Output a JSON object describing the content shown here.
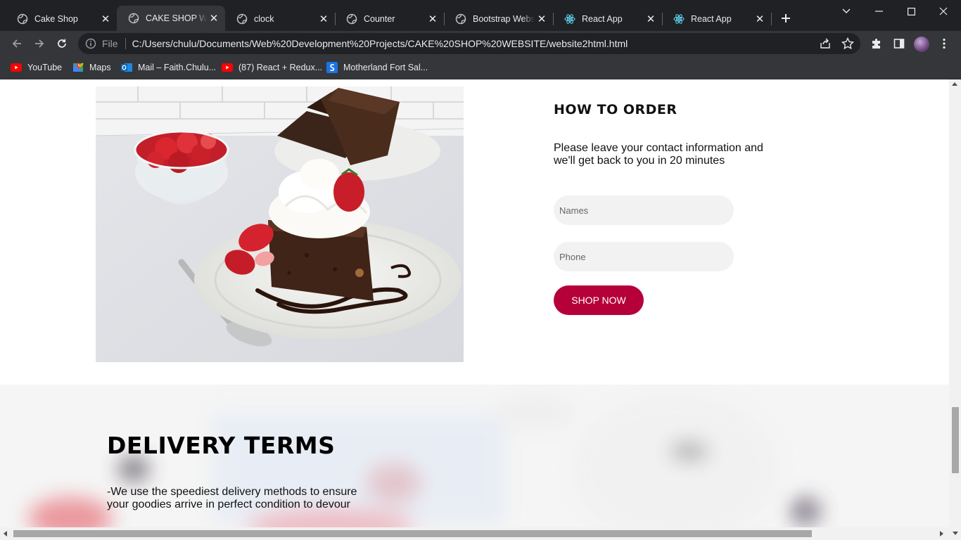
{
  "browser": {
    "tabs": [
      {
        "title": "Cake Shop",
        "icon": "globe-icon",
        "active": false
      },
      {
        "title": "CAKE SHOP WEBSITE",
        "icon": "globe-icon",
        "active": true
      },
      {
        "title": "clock",
        "icon": "globe-icon",
        "active": false
      },
      {
        "title": "Counter",
        "icon": "globe-icon",
        "active": false
      },
      {
        "title": "Bootstrap Website",
        "icon": "globe-icon",
        "active": false
      },
      {
        "title": "React App",
        "icon": "react-icon",
        "active": false
      },
      {
        "title": "React App",
        "icon": "react-icon",
        "active": false
      }
    ],
    "omnibox": {
      "scheme": "File",
      "url": "C:/Users/chulu/Documents/Web%20Development%20Projects/CAKE%20SHOP%20WEBSITE/website2html.html"
    },
    "bookmarks": [
      {
        "label": "YouTube",
        "icon": "youtube-icon"
      },
      {
        "label": "Maps",
        "icon": "maps-icon"
      },
      {
        "label": "Mail – Faith.Chulu...",
        "icon": "outlook-icon"
      },
      {
        "label": "(87) React + Redux...",
        "icon": "youtube-icon"
      },
      {
        "label": "Motherland Fort Sal...",
        "icon": "shopify-icon"
      }
    ],
    "colors": {
      "chrome_dark": "#202124",
      "chrome_toolbar": "#35363a",
      "text": "#e8eaed"
    }
  },
  "page": {
    "order": {
      "title": "HOW TO ORDER",
      "description": "Please leave your contact information and we'll get back to you in 20 minutes",
      "names_placeholder": "Names",
      "phone_placeholder": "Phone",
      "button_label": "SHOP NOW"
    },
    "delivery": {
      "title": "DELIVERY TERMS",
      "text": "-We use the speediest delivery methods to ensure your goodies arrive in perfect condition to devour"
    },
    "colors": {
      "accent": "#b5003a",
      "field_bg": "#f2f2f2"
    }
  }
}
